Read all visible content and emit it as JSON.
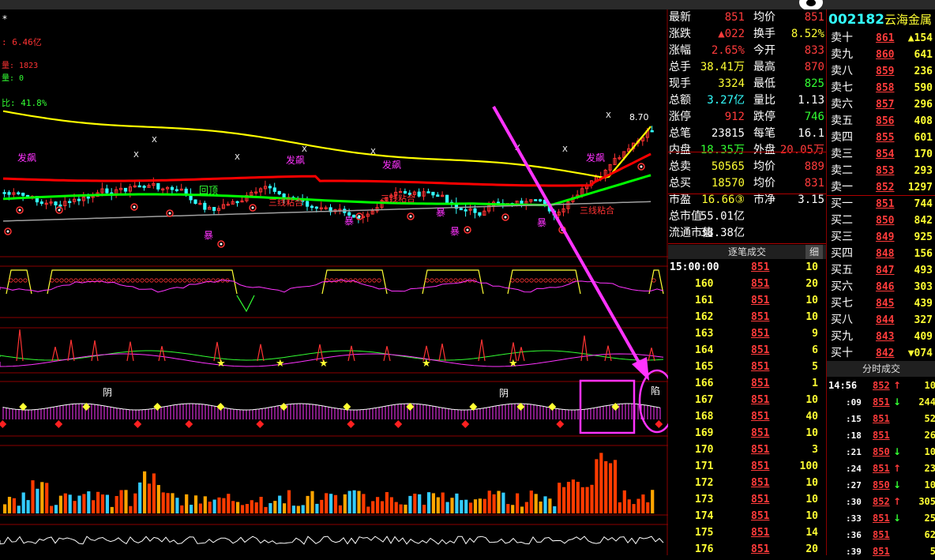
{
  "chart": {
    "legend_top": [
      "6.46亿",
      "1823",
      "0"
    ],
    "legend_pct": "41.8%",
    "tag_fa_biao": "发飙",
    "tag_hui_ding": "回顶",
    "tag_san_xian": "三线粘合",
    "tag_bao": "暴",
    "tag_yin": "阴",
    "tag_xian": "陷",
    "price_label": "8.70",
    "marker_x": "X",
    "colors": {
      "up": "#ff3333",
      "down": "#33ffff",
      "ma1": "#ffff00",
      "ma2": "#ff0000",
      "ma3": "#00ff00",
      "ma4": "#a0a0a0",
      "magenta": "#ff33ff"
    }
  },
  "quote": {
    "title_code": "002182",
    "title_name": "云海金属",
    "rows": [
      {
        "l1": "最新",
        "v1": "851",
        "c1": "red",
        "l2": "均价",
        "v2": "851",
        "c2": "red"
      },
      {
        "l1": "涨跌",
        "v1": "▲022",
        "c1": "red",
        "l2": "换手",
        "v2": "8.52%",
        "c2": "yellow"
      },
      {
        "l1": "涨幅",
        "v1": "2.65%",
        "c1": "red",
        "l2": "今开",
        "v2": "833",
        "c2": "red"
      },
      {
        "l1": "总手",
        "v1": "38.41万",
        "c1": "yellow",
        "l2": "最高",
        "v2": "870",
        "c2": "red"
      },
      {
        "l1": "现手",
        "v1": "3324",
        "c1": "yellow",
        "l2": "最低",
        "v2": "825",
        "c2": "green"
      },
      {
        "l1": "总额",
        "v1": "3.27亿",
        "c1": "cyan",
        "l2": "量比",
        "v2": "1.13",
        "c2": "white"
      },
      {
        "l1": "涨停",
        "v1": "912",
        "c1": "red",
        "l2": "跌停",
        "v2": "746",
        "c2": "green"
      },
      {
        "l1": "总笔",
        "v1": "23815",
        "c1": "white",
        "l2": "每笔",
        "v2": "16.1",
        "c2": "white"
      },
      {
        "l1": "内盘",
        "v1": "18.35万",
        "c1": "green",
        "l2": "外盘",
        "v2": "20.05万",
        "c2": "red"
      },
      {
        "l1": "总卖",
        "v1": "50565",
        "c1": "yellow",
        "l2": "均价",
        "v2": "889",
        "c2": "red"
      },
      {
        "l1": "总买",
        "v1": "18570",
        "c1": "yellow",
        "l2": "均价",
        "v2": "831",
        "c2": "red"
      },
      {
        "l1": "市盈",
        "v1": "16.66③",
        "c1": "yellow",
        "l2": "市净",
        "v2": "3.15",
        "c2": "white"
      },
      {
        "l1": "总市值",
        "v1": "55.01亿",
        "c1": "white",
        "l2": "",
        "v2": "",
        "c2": "white"
      },
      {
        "l1": "流通市值",
        "v1": "38.38亿",
        "c1": "white",
        "l2": "",
        "v2": "",
        "c2": "white"
      }
    ],
    "tick_header": "逐笔成交",
    "tick_detail_tab": "细",
    "ticks": [
      {
        "t": "15:00:00",
        "p": "851",
        "v": "10"
      },
      {
        "t": "160",
        "p": "851",
        "v": "20"
      },
      {
        "t": "161",
        "p": "851",
        "v": "10"
      },
      {
        "t": "162",
        "p": "851",
        "v": "10"
      },
      {
        "t": "163",
        "p": "851",
        "v": "9"
      },
      {
        "t": "164",
        "p": "851",
        "v": "6"
      },
      {
        "t": "165",
        "p": "851",
        "v": "5"
      },
      {
        "t": "166",
        "p": "851",
        "v": "1"
      },
      {
        "t": "167",
        "p": "851",
        "v": "10"
      },
      {
        "t": "168",
        "p": "851",
        "v": "40"
      },
      {
        "t": "169",
        "p": "851",
        "v": "10"
      },
      {
        "t": "170",
        "p": "851",
        "v": "3"
      },
      {
        "t": "171",
        "p": "851",
        "v": "100"
      },
      {
        "t": "172",
        "p": "851",
        "v": "10"
      },
      {
        "t": "173",
        "p": "851",
        "v": "10"
      },
      {
        "t": "174",
        "p": "851",
        "v": "10"
      },
      {
        "t": "175",
        "p": "851",
        "v": "14"
      },
      {
        "t": "176",
        "p": "851",
        "v": "20"
      }
    ]
  },
  "book": {
    "asks": [
      {
        "l": "卖十",
        "p": "861",
        "v": "▲154"
      },
      {
        "l": "卖九",
        "p": "860",
        "v": "641"
      },
      {
        "l": "卖八",
        "p": "859",
        "v": "236"
      },
      {
        "l": "卖七",
        "p": "858",
        "v": "590"
      },
      {
        "l": "卖六",
        "p": "857",
        "v": "296"
      },
      {
        "l": "卖五",
        "p": "856",
        "v": "408"
      },
      {
        "l": "卖四",
        "p": "855",
        "v": "601"
      },
      {
        "l": "卖三",
        "p": "854",
        "v": "170"
      },
      {
        "l": "卖二",
        "p": "853",
        "v": "293"
      },
      {
        "l": "卖一",
        "p": "852",
        "v": "1297"
      }
    ],
    "bids": [
      {
        "l": "买一",
        "p": "851",
        "v": "744"
      },
      {
        "l": "买二",
        "p": "850",
        "v": "842"
      },
      {
        "l": "买三",
        "p": "849",
        "v": "925"
      },
      {
        "l": "买四",
        "p": "848",
        "v": "156"
      },
      {
        "l": "买五",
        "p": "847",
        "v": "493"
      },
      {
        "l": "买六",
        "p": "846",
        "v": "303"
      },
      {
        "l": "买七",
        "p": "845",
        "v": "439"
      },
      {
        "l": "买八",
        "p": "844",
        "v": "327"
      },
      {
        "l": "买九",
        "p": "843",
        "v": "409"
      },
      {
        "l": "买十",
        "p": "842",
        "v": "▼074"
      }
    ],
    "trades_header": "分时成交",
    "trades": [
      {
        "t": "14:56",
        "p": "852",
        "a": "↑",
        "ac": "red",
        "v": "10"
      },
      {
        "t": ":09",
        "p": "851",
        "a": "↓",
        "ac": "green",
        "v": "244"
      },
      {
        "t": ":15",
        "p": "851",
        "a": "",
        "ac": "white",
        "v": "52"
      },
      {
        "t": ":18",
        "p": "851",
        "a": "",
        "ac": "white",
        "v": "26"
      },
      {
        "t": ":21",
        "p": "850",
        "a": "↓",
        "ac": "green",
        "v": "10"
      },
      {
        "t": ":24",
        "p": "851",
        "a": "↑",
        "ac": "red",
        "v": "23"
      },
      {
        "t": ":27",
        "p": "850",
        "a": "↓",
        "ac": "green",
        "v": "10"
      },
      {
        "t": ":30",
        "p": "852",
        "a": "↑",
        "ac": "red",
        "v": "305"
      },
      {
        "t": ":33",
        "p": "851",
        "a": "↓",
        "ac": "green",
        "v": "25"
      },
      {
        "t": ":36",
        "p": "851",
        "a": "",
        "ac": "white",
        "v": "62"
      },
      {
        "t": ":39",
        "p": "851",
        "a": "",
        "ac": "white",
        "v": "5"
      }
    ]
  }
}
